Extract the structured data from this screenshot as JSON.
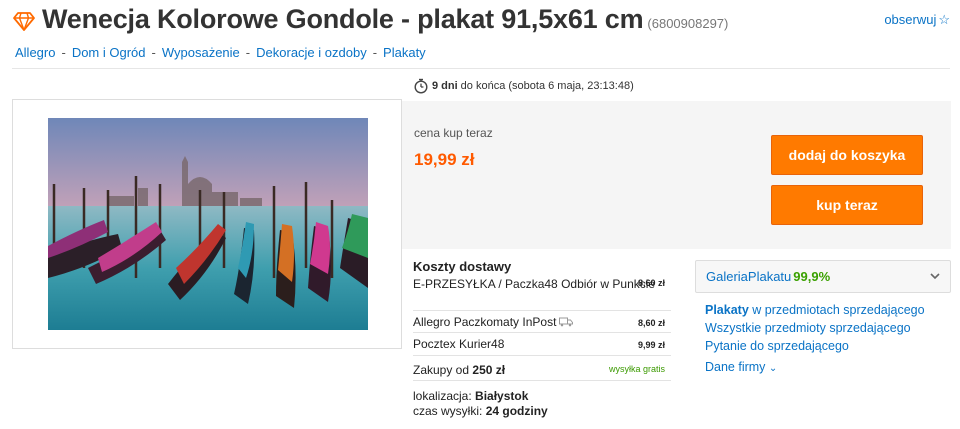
{
  "header": {
    "title": "Wenecja Kolorowe Gondole - plakat 91,5x61 cm",
    "item_id": "(6800908297)",
    "watch_label": "obserwuj"
  },
  "breadcrumb": [
    "Allegro",
    "Dom i Ogród",
    "Wyposażenie",
    "Dekoracje i ozdoby",
    "Plakaty"
  ],
  "timer": {
    "bold": "9 dni",
    "text": "do końca (sobota 6 maja, 23:13:48)"
  },
  "buy": {
    "price_label": "cena kup teraz",
    "price": "19,99 zł",
    "add_to_cart": "dodaj do koszyka",
    "buy_now": "kup teraz"
  },
  "shipping": {
    "title": "Koszty dostawy",
    "options": [
      {
        "name": "E-PRZESYŁKA / Paczka48 Odbiór w Punkcie",
        "price": "8,60 zł"
      },
      {
        "name": "Allegro Paczkomaty InPost",
        "price": "8,60 zł"
      },
      {
        "name": "Pocztex Kurier48",
        "price": "9,99 zł"
      }
    ],
    "free_prefix": "Zakupy od",
    "free_amount": "250 zł",
    "free_label": "wysyłka gratis",
    "location_label": "lokalizacja:",
    "location": "Białystok",
    "dispatch_label": "czas wysyłki:",
    "dispatch": "24 godziny"
  },
  "seller": {
    "name": "GaleriaPlakatu",
    "rating": "99,9%",
    "links_bold": "Plakaty",
    "links_rest": "w przedmiotach sprzedającego",
    "all_items": "Wszystkie przedmioty sprzedającego",
    "ask": "Pytanie do sprzedającego",
    "company": "Dane firmy"
  },
  "colors": {
    "accent": "#ff7a00",
    "price": "#ff5a00",
    "link": "#0a73c6",
    "rating": "#3aa000"
  }
}
